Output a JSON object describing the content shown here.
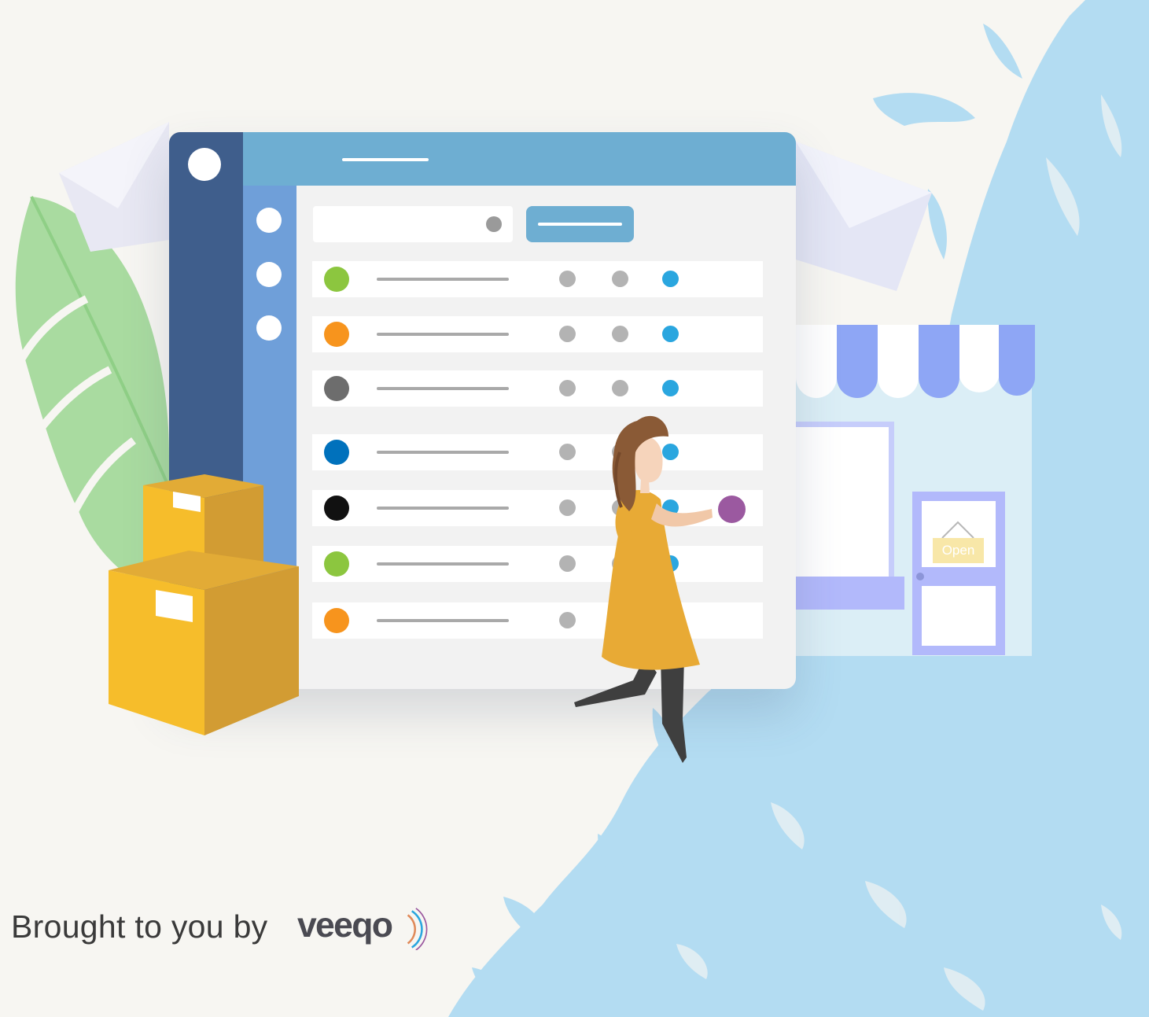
{
  "footer": {
    "tagline": "Brought to you by",
    "brand_logo": "veeqo"
  },
  "store": {
    "sign_text": "Open"
  },
  "order_rows": [
    {
      "status_color": "#8cc63f",
      "blue_dot": true
    },
    {
      "status_color": "#f7941d",
      "blue_dot": true
    },
    {
      "status_color": "#6d6d6d",
      "blue_dot": true
    },
    {
      "status_color": "#0071bc",
      "blue_dot": true
    },
    {
      "status_color": "#111111",
      "blue_dot": true
    },
    {
      "status_color": "#8cc63f",
      "blue_dot": true
    },
    {
      "status_color": "#f7941d",
      "blue_dot": true
    }
  ],
  "colors": {
    "sidebar_dark": "#3f5e8c",
    "sidebar_light": "#6f9fd9",
    "header": "#6eaed2",
    "water": "#b3dcf2",
    "box_front": "#f6bd2b",
    "box_side": "#d29c33",
    "dress": "#e8aa35",
    "hair": "#8a5a36",
    "handled_order": "#9b59a0"
  }
}
